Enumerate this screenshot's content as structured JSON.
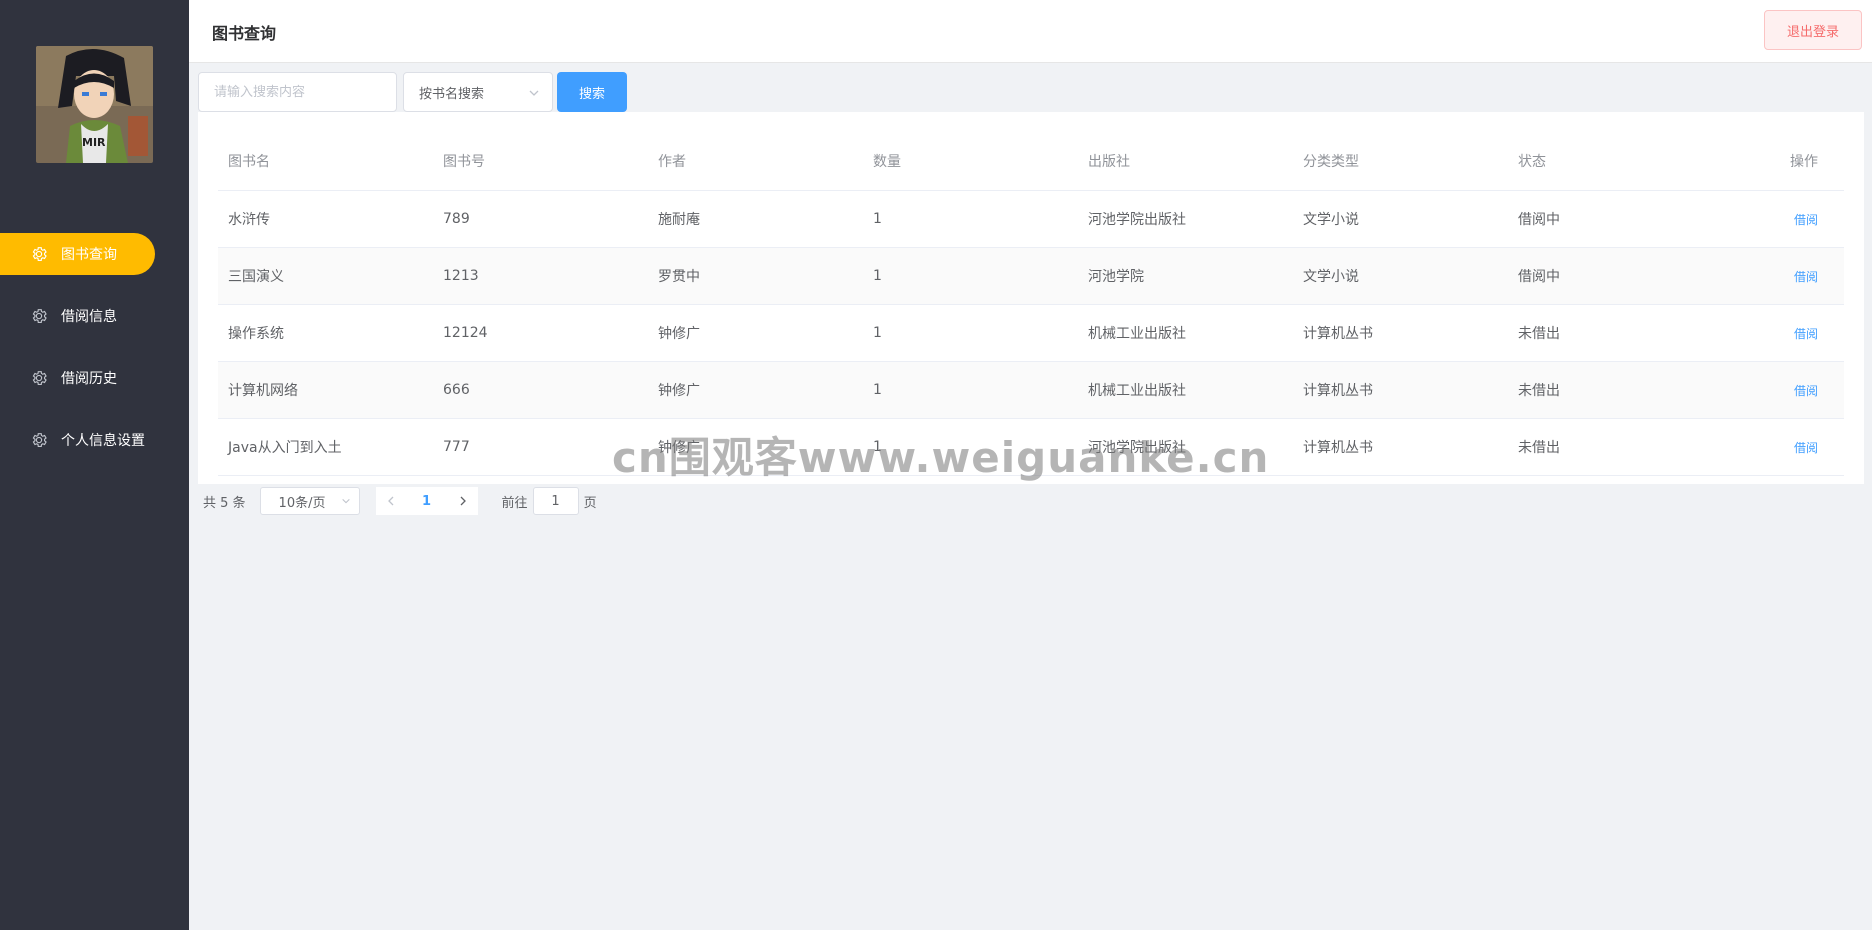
{
  "header": {
    "title": "图书查询",
    "logout_label": "退出登录"
  },
  "sidebar": {
    "items": [
      {
        "label": "图书查询",
        "icon": "gear-icon",
        "active": true
      },
      {
        "label": "借阅信息",
        "icon": "gear-icon",
        "active": false
      },
      {
        "label": "借阅历史",
        "icon": "gear-icon",
        "active": false
      },
      {
        "label": "个人信息设置",
        "icon": "gear-icon",
        "active": false
      }
    ]
  },
  "search": {
    "placeholder": "请输入搜索内容",
    "value": "",
    "mode_selected": "按书名搜索",
    "button_label": "搜索"
  },
  "table": {
    "columns": [
      "图书名",
      "图书号",
      "作者",
      "数量",
      "出版社",
      "分类类型",
      "状态",
      "操作"
    ],
    "rows": [
      {
        "name": "水浒传",
        "number": "789",
        "author": "施耐庵",
        "count": "1",
        "publisher": "河池学院出版社",
        "category": "文学小说",
        "status": "借阅中",
        "action": "借阅"
      },
      {
        "name": "三国演义",
        "number": "1213",
        "author": "罗贯中",
        "count": "1",
        "publisher": "河池学院",
        "category": "文学小说",
        "status": "借阅中",
        "action": "借阅"
      },
      {
        "name": "操作系统",
        "number": "12124",
        "author": "钟修广",
        "count": "1",
        "publisher": "机械工业出版社",
        "category": "计算机丛书",
        "status": "未借出",
        "action": "借阅"
      },
      {
        "name": "计算机网络",
        "number": "666",
        "author": "钟修广",
        "count": "1",
        "publisher": "机械工业出版社",
        "category": "计算机丛书",
        "status": "未借出",
        "action": "借阅"
      },
      {
        "name": "Java从入门到入土",
        "number": "777",
        "author": "钟修广",
        "count": "1",
        "publisher": "河池学院出版社",
        "category": "计算机丛书",
        "status": "未借出",
        "action": "借阅"
      }
    ]
  },
  "pagination": {
    "total_label": "共 5 条",
    "page_size": "10条/页",
    "current_page": "1",
    "goto_prefix": "前往",
    "goto_value": "1",
    "goto_suffix": "页"
  },
  "watermark": "cn围观客www.weiguanke.cn",
  "colors": {
    "sidebar_bg": "#30333e",
    "active_menu": "#ffbb00",
    "primary": "#409eff",
    "danger": "#f56c6c"
  }
}
